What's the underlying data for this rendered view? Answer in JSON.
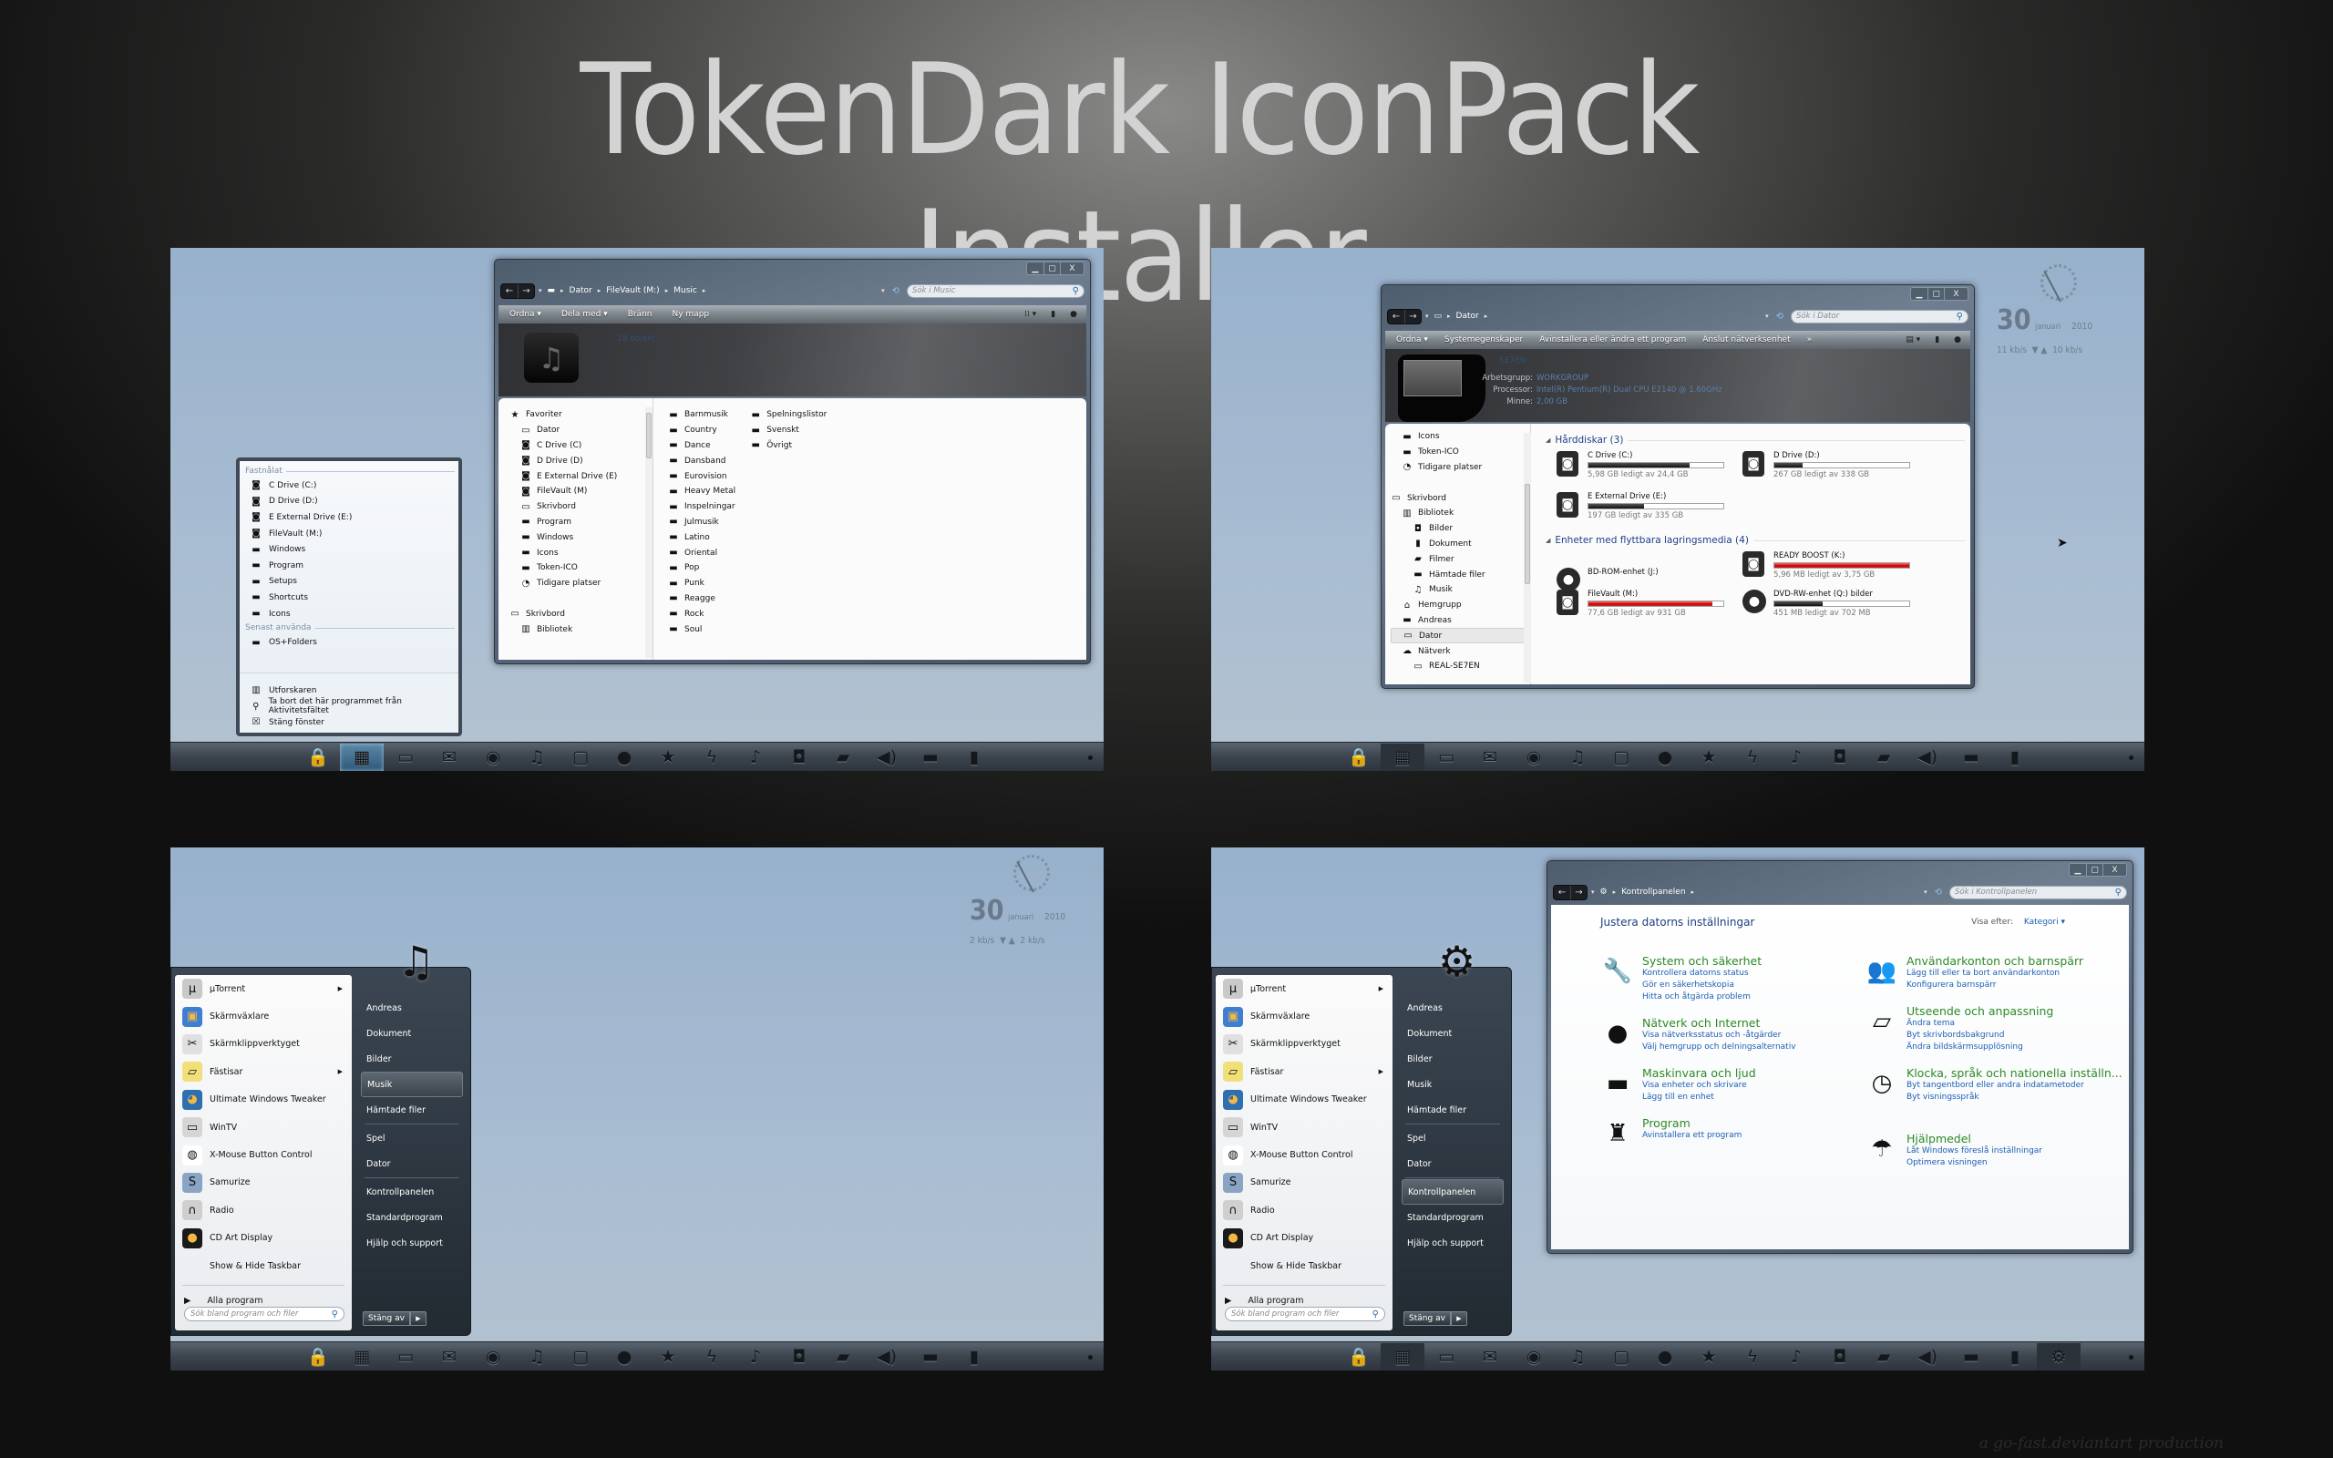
{
  "title": "TokenDark IconPack Installer",
  "credit": "a go-fast.deviantart production",
  "taskbar": {
    "icons": [
      "lock-icon",
      "library-icon",
      "laptop-icon",
      "mail-icon",
      "firefox-icon",
      "headphones-icon",
      "display-icon",
      "chat-icon",
      "star-icon",
      "bolt-icon",
      "music-icon",
      "camera-icon",
      "clapper-icon",
      "speaker-icon",
      "folder-icon",
      "trash-icon"
    ],
    "glyphs": [
      "🔒",
      "▦",
      "▭",
      "✉",
      "◉",
      "♫",
      "▢",
      "●",
      "★",
      "ϟ",
      "♪",
      "◘",
      "▰",
      "◀)",
      "▬",
      "▮"
    ]
  },
  "panel1": {
    "window": {
      "breadcrumbs": [
        "Dator",
        "FileVault (M:)",
        "Music"
      ],
      "search_placeholder": "Sök i Music",
      "toolbar": [
        "Ordna ▾",
        "Dela med ▾",
        "Bränn",
        "Ny mapp"
      ],
      "item_count": "18 objekt",
      "nav": [
        {
          "icon": "★",
          "label": "Favoriter",
          "indent": 0
        },
        {
          "icon": "▭",
          "label": "Dator",
          "indent": 1
        },
        {
          "icon": "◙",
          "label": "C Drive (C)",
          "indent": 1
        },
        {
          "icon": "◙",
          "label": "D Drive (D)",
          "indent": 1
        },
        {
          "icon": "◙",
          "label": "E External Drive (E)",
          "indent": 1
        },
        {
          "icon": "◙",
          "label": "FileVault (M)",
          "indent": 1
        },
        {
          "icon": "▭",
          "label": "Skrivbord",
          "indent": 1
        },
        {
          "icon": "▬",
          "label": "Program",
          "indent": 1
        },
        {
          "icon": "▬",
          "label": "Windows",
          "indent": 1
        },
        {
          "icon": "▬",
          "label": "Icons",
          "indent": 1
        },
        {
          "icon": "▬",
          "label": "Token-ICO",
          "indent": 1
        },
        {
          "icon": "◔",
          "label": "Tidigare platser",
          "indent": 1
        },
        {
          "icon": "",
          "label": "",
          "indent": 0
        },
        {
          "icon": "▭",
          "label": "Skrivbord",
          "indent": 0
        },
        {
          "icon": "▥",
          "label": "Bibliotek",
          "indent": 1
        }
      ],
      "folders_col1": [
        "Barnmusik",
        "Country",
        "Dance",
        "Dansband",
        "Eurovision",
        "Heavy Metal",
        "Inspelningar",
        "Julmusik",
        "Latino",
        "Oriental",
        "Pop",
        "Punk",
        "Reagge",
        "Rock",
        "Soul"
      ],
      "folders_col2": [
        "Spelningslistor",
        "Svenskt",
        "Övrigt"
      ]
    },
    "jumplist": {
      "pinned_header": "Fastnålat",
      "pinned": [
        {
          "icon": "◙",
          "label": "C Drive (C:)"
        },
        {
          "icon": "◙",
          "label": "D Drive (D:)"
        },
        {
          "icon": "◙",
          "label": "E External Drive (E:)"
        },
        {
          "icon": "◙",
          "label": "FileVault (M:)"
        },
        {
          "icon": "▬",
          "label": "Windows"
        },
        {
          "icon": "▬",
          "label": "Program"
        },
        {
          "icon": "▬",
          "label": "Setups"
        },
        {
          "icon": "▬",
          "label": "Shortcuts"
        },
        {
          "icon": "▬",
          "label": "Icons"
        }
      ],
      "recent_header": "Senast använda",
      "recent": [
        {
          "icon": "▬",
          "label": "OS+Folders"
        }
      ],
      "actions": [
        {
          "icon": "▥",
          "label": "Utforskaren"
        },
        {
          "icon": "⚲",
          "label": "Ta bort det här programmet från Aktivitetsfältet"
        },
        {
          "icon": "☒",
          "label": "Stäng fönster"
        }
      ]
    }
  },
  "panel2": {
    "gadget": {
      "day": "30",
      "month": "januari",
      "year": "2010",
      "down": "11 kb/s",
      "up": "10 kb/s"
    },
    "window": {
      "breadcrumbs": [
        "Dator"
      ],
      "search_placeholder": "Sök i Dator",
      "toolbar": [
        "Ordna ▾",
        "Systemegenskaper",
        "Avinstallera eller ändra ett program",
        "Anslut nätverksenhet",
        "»"
      ],
      "computer_name": "SE7EN",
      "props": [
        {
          "label": "Arbetsgrupp:",
          "value": "WORKGROUP"
        },
        {
          "label": "Processor:",
          "value": "Intel(R) Pentium(R) Dual  CPU  E2140  @ 1.60GHz"
        },
        {
          "label": "Minne:",
          "value": "2,00 GB"
        }
      ],
      "nav": [
        {
          "icon": "▬",
          "label": "Icons",
          "indent": 1
        },
        {
          "icon": "▬",
          "label": "Token-ICO",
          "indent": 1
        },
        {
          "icon": "◔",
          "label": "Tidigare platser",
          "indent": 1
        },
        {
          "icon": "",
          "label": "",
          "indent": 0
        },
        {
          "icon": "▭",
          "label": "Skrivbord",
          "indent": 0
        },
        {
          "icon": "▥",
          "label": "Bibliotek",
          "indent": 1
        },
        {
          "icon": "◘",
          "label": "Bilder",
          "indent": 2
        },
        {
          "icon": "▮",
          "label": "Dokument",
          "indent": 2
        },
        {
          "icon": "▰",
          "label": "Filmer",
          "indent": 2
        },
        {
          "icon": "▬",
          "label": "Hämtade filer",
          "indent": 2
        },
        {
          "icon": "♫",
          "label": "Musik",
          "indent": 2
        },
        {
          "icon": "⌂",
          "label": "Hemgrupp",
          "indent": 1
        },
        {
          "icon": "▬",
          "label": "Andreas",
          "indent": 1
        },
        {
          "icon": "▭",
          "label": "Dator",
          "indent": 1,
          "selected": true
        },
        {
          "icon": "☁",
          "label": "Nätverk",
          "indent": 1
        },
        {
          "icon": "▭",
          "label": "REAL-SE7EN",
          "indent": 2
        }
      ],
      "hdd_header": "Hårddiskar (3)",
      "hdd": [
        {
          "name": "C Drive (C:)",
          "free": "5,98 GB ledigt av 24,4 GB",
          "used_pct": 75,
          "red": false
        },
        {
          "name": "D Drive (D:)",
          "free": "267 GB ledigt av 338 GB",
          "used_pct": 21,
          "red": false
        },
        {
          "name": "E External Drive (E:)",
          "free": "197 GB ledigt av 335 GB",
          "used_pct": 41,
          "red": false
        }
      ],
      "removable_header": "Enheter med flyttbara lagringsmedia (4)",
      "removable": [
        {
          "name": "BD-ROM-enhet (J:)",
          "free": "",
          "used_pct": null,
          "red": false
        },
        {
          "name": "READY BOOST (K:)",
          "free": "5,96 MB ledigt av 3,75 GB",
          "used_pct": 100,
          "red": true
        },
        {
          "name": "FileVault (M:)",
          "free": "77,6 GB ledigt av 931 GB",
          "used_pct": 92,
          "red": true
        },
        {
          "name": "DVD-RW-enhet (Q:) bilder",
          "free": "451 MB ledigt av 702 MB",
          "used_pct": 36,
          "red": false
        }
      ]
    }
  },
  "panel3": {
    "gadget": {
      "day": "30",
      "month": "januari",
      "year": "2010",
      "down": "2 kb/s",
      "up": "2 kb/s"
    },
    "start": {
      "glyph": "♫",
      "programs": [
        {
          "icon": "µ",
          "label": "µTorrent",
          "submenu": true,
          "color": "#c9c9c9"
        },
        {
          "icon": "▣",
          "label": "Skärmväxlare",
          "submenu": false,
          "color": "#3e7fd1"
        },
        {
          "icon": "✂",
          "label": "Skärmklippverktyget",
          "submenu": false,
          "color": "#e0e0e0"
        },
        {
          "icon": "▱",
          "label": "Fästisar",
          "submenu": true,
          "color": "#f1e07a"
        },
        {
          "icon": "◕",
          "label": "Ultimate Windows Tweaker",
          "submenu": false,
          "color": "#2e6fb0"
        },
        {
          "icon": "▭",
          "label": "WinTV",
          "submenu": false,
          "color": "#d5d5d5"
        },
        {
          "icon": "◍",
          "label": "X-Mouse Button Control",
          "submenu": false,
          "color": "#fff"
        },
        {
          "icon": "S",
          "label": "Samurize",
          "submenu": false,
          "color": "#8aa4c4"
        },
        {
          "icon": "∩",
          "label": "Radio",
          "submenu": false,
          "color": "#cfcfcf"
        },
        {
          "icon": "●",
          "label": "CD Art Display",
          "submenu": false,
          "color": "#1a1a1a"
        },
        {
          "icon": "",
          "label": "Show & Hide Taskbar",
          "submenu": false,
          "color": "transparent"
        }
      ],
      "all_programs": "Alla program",
      "search_placeholder": "Sök bland program och filer",
      "right": [
        "Andreas",
        "Dokument",
        "Bilder",
        "Musik",
        "Hämtade filer",
        "|",
        "Spel",
        "Dator",
        "|",
        "Kontrollpanelen",
        "Standardprogram",
        "Hjälp och support"
      ],
      "highlighted": "Musik",
      "shutdown": "Stäng av"
    }
  },
  "panel4": {
    "start": {
      "glyph": "⚙",
      "highlighted": "Kontrollpanelen"
    },
    "window": {
      "breadcrumbs": [
        "Kontrollpanelen"
      ],
      "search_placeholder": "Sök i Kontrollpanelen",
      "heading": "Justera datorns inställningar",
      "view_by_label": "Visa efter:",
      "view_by_value": "Kategori ▾",
      "categories_left": [
        {
          "icon": "🔧",
          "title": "System och säkerhet",
          "links": [
            "Kontrollera datorns status",
            "Gör en säkerhetskopia",
            "Hitta och åtgärda problem"
          ]
        },
        {
          "icon": "●",
          "title": "Nätverk och Internet",
          "links": [
            "Visa nätverksstatus och -åtgärder",
            "Välj hemgrupp och delningsalternativ"
          ]
        },
        {
          "icon": "▬",
          "title": "Maskinvara och ljud",
          "links": [
            "Visa enheter och skrivare",
            "Lägg till en enhet"
          ]
        },
        {
          "icon": "♜",
          "title": "Program",
          "links": [
            "Avinstallera ett program"
          ]
        }
      ],
      "categories_right": [
        {
          "icon": "👥",
          "title": "Användarkonton och barnspärr",
          "links": [
            "Lägg till eller ta bort användarkonton",
            "Konfigurera barnspärr"
          ]
        },
        {
          "icon": "▱",
          "title": "Utseende och anpassning",
          "links": [
            "Ändra tema",
            "Byt skrivbordsbakgrund",
            "Ändra bildskärmsupplösning"
          ]
        },
        {
          "icon": "◷",
          "title": "Klocka, språk och nationella inställn...",
          "links": [
            "Byt tangentbord eller andra indatametoder",
            "Byt visningsspråk"
          ]
        },
        {
          "icon": "☂",
          "title": "Hjälpmedel",
          "links": [
            "Låt Windows föreslå inställningar",
            "Optimera visningen"
          ]
        }
      ]
    }
  }
}
